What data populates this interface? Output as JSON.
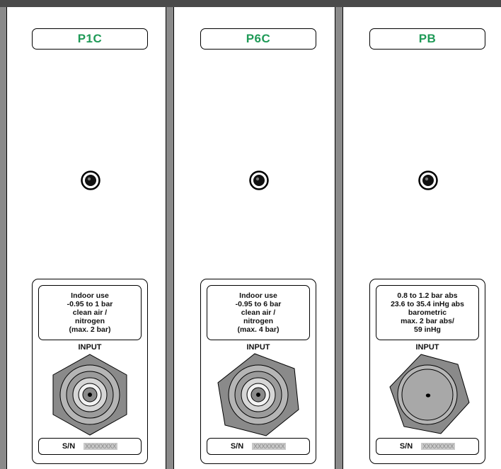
{
  "modules": [
    {
      "title": "P1C",
      "spec": [
        "Indoor use",
        "-0.95 to 1 bar",
        "clean air /",
        "nitrogen",
        "(max. 2 bar)"
      ],
      "input_label": "INPUT",
      "connector": "standard-fitting",
      "sn_label": "S/N",
      "sn_value": "XXXXXXXX"
    },
    {
      "title": "P6C",
      "spec": [
        "Indoor use",
        "-0.95 to 6 bar",
        "clean air /",
        "nitrogen",
        "(max. 4 bar)"
      ],
      "input_label": "INPUT",
      "connector": "standard-fitting",
      "sn_label": "S/N",
      "sn_value": "XXXXXXXX"
    },
    {
      "title": "PB",
      "spec": [
        "0.8 to 1.2 bar abs",
        "23.6 to 35.4 inHg abs",
        "barometric",
        "max. 2 bar abs/",
        "59 inHg"
      ],
      "input_label": "INPUT",
      "connector": "barometric-port",
      "sn_label": "S/N",
      "sn_value": "XXXXXXXX"
    }
  ],
  "colors": {
    "title_green": "#1f9a57",
    "rack": "#4f4f4f",
    "panel": "#ffffff"
  }
}
